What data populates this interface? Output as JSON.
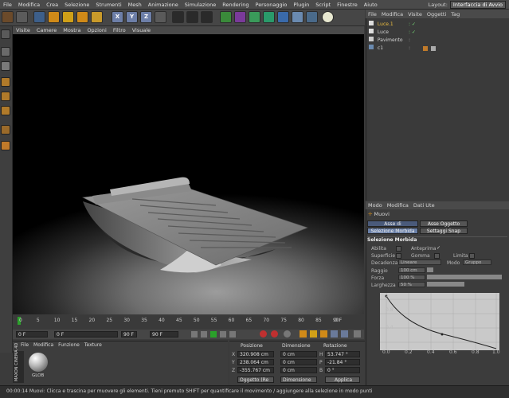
{
  "menu": {
    "items": [
      "File",
      "Modifica",
      "Crea",
      "Selezione",
      "Strumenti",
      "Mesh",
      "Animazione",
      "Simulazione",
      "Rendering",
      "Personaggio",
      "Plugin",
      "Script",
      "Finestre",
      "Aiuto"
    ],
    "layout_label": "Layout:",
    "layout_value": "Interfaccia di Avvio"
  },
  "viewport": {
    "menu": [
      "Visite",
      "Camere",
      "Mostra",
      "Opzioni",
      "Filtro",
      "Visuale"
    ]
  },
  "timeline": {
    "ticks": [
      "0",
      "5",
      "10",
      "15",
      "20",
      "25",
      "30",
      "35",
      "40",
      "45",
      "50",
      "55",
      "60",
      "65",
      "70",
      "75",
      "80",
      "85",
      "90"
    ],
    "frame_end_label": "0 F",
    "start_field": "0 F",
    "mid_field": "0 F",
    "end_field_a": "90 F",
    "end_field_b": "90 F"
  },
  "material": {
    "menu": [
      "File",
      "Modifica",
      "Funzione",
      "Texture"
    ],
    "thumb_label": "GLOB",
    "brand": "MAXON CINEMA 4D"
  },
  "coords": {
    "headers": [
      "Posizione",
      "Dimensione",
      "Rotazione"
    ],
    "rows": [
      {
        "axis": "X",
        "pos": "320.908 cm",
        "dim": "0 cm",
        "rot_axis": "H",
        "rot": "53.747 °"
      },
      {
        "axis": "Y",
        "pos": "238.064 cm",
        "dim": "0 cm",
        "rot_axis": "P",
        "rot": "-21.84 °"
      },
      {
        "axis": "Z",
        "pos": "-355.767 cm",
        "dim": "0 cm",
        "rot_axis": "B",
        "rot": "0 °"
      }
    ],
    "mode_a": "Oggetto (Re",
    "mode_b": "Dimensione",
    "apply": "Applica"
  },
  "objects": {
    "menu": [
      "File",
      "Modifica",
      "Visite",
      "Oggetti",
      "Tag"
    ],
    "items": [
      "Luce.1",
      "Luce",
      "Pavimento",
      "c1"
    ],
    "colors": [
      "#f0c040",
      "#e0e0e0",
      "#e0e0e0",
      "#e0e0e0"
    ]
  },
  "attributes": {
    "menu": [
      "Modo",
      "Modifica",
      "Dati Ute"
    ],
    "tool_name": "Muovi",
    "tabs": [
      "Asse di Modellazione",
      "Asse Oggetto",
      "Selezione Morbida",
      "Settaggi Snap"
    ],
    "section": "Selezione Morbida",
    "abilita": "Abilita",
    "anteprima": "Anteprima",
    "superficie": "Superficie",
    "gomma": "Gomma",
    "limita": "Limita",
    "decadenza_label": "Decadenza",
    "decadenza_value": "Lineare",
    "modo_label": "Modo",
    "modo_value": "Gruppo",
    "raggio_label": "Raggio",
    "raggio_value": "100 cm",
    "forza_label": "Forza",
    "forza_value": "100 %",
    "larghezza_label": "Larghezza",
    "larghezza_value": "50 %",
    "graph_y": [
      "1",
      "0.8",
      "0.4"
    ],
    "graph_x": [
      "0.0",
      "0.2",
      "0.4",
      "0.6",
      "0.8",
      "1.0"
    ]
  },
  "status": "00:00:14  Muovi: Clicca e trascina per muovere gli elementi. Tieni premuto SHIFT per quantificare il movimento / aggiungere alla selezione in modo punti"
}
